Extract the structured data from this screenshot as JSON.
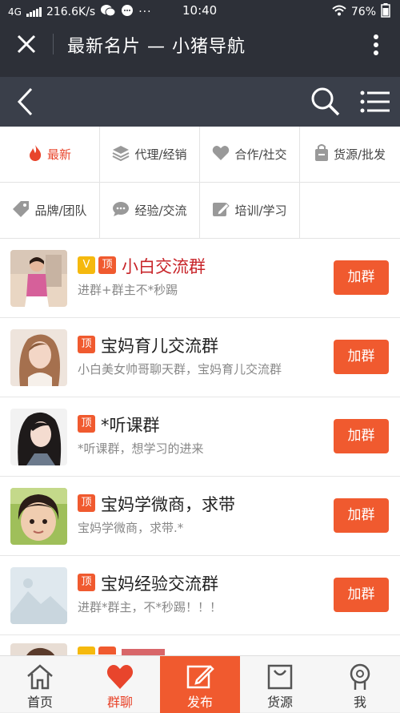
{
  "status_bar": {
    "network": "4G",
    "speed": "216.6K/s",
    "time": "10:40",
    "battery": "76%"
  },
  "wechat_header": {
    "title": "最新名片 — 小猪导航"
  },
  "categories": [
    {
      "label": "最新",
      "icon": "fire-icon",
      "active": true
    },
    {
      "label": "代理/经销",
      "icon": "layers-icon",
      "active": false
    },
    {
      "label": "合作/社交",
      "icon": "heart-icon",
      "active": false
    },
    {
      "label": "货源/批发",
      "icon": "bag-icon",
      "active": false
    },
    {
      "label": "品牌/团队",
      "icon": "tag-icon",
      "active": false
    },
    {
      "label": "经验/交流",
      "icon": "chat-icon",
      "active": false
    },
    {
      "label": "培训/学习",
      "icon": "edit-icon",
      "active": false
    }
  ],
  "groups": [
    {
      "name": "小白交流群",
      "desc": "进群+群主不*秒踢",
      "vip": true,
      "vip_label": "V",
      "top_label": "顶",
      "join_label": "加群"
    },
    {
      "name": "宝妈育儿交流群",
      "desc": "小白美女帅哥聊天群，宝妈育儿交流群",
      "vip": false,
      "top_label": "顶",
      "join_label": "加群"
    },
    {
      "name": "*听课群",
      "desc": "*听课群，想学习的进来",
      "vip": false,
      "top_label": "顶",
      "join_label": "加群"
    },
    {
      "name": "宝妈学微商，求带",
      "desc": "宝妈学微商，求带.*",
      "vip": false,
      "top_label": "顶",
      "join_label": "加群"
    },
    {
      "name": "宝妈经验交流群",
      "desc": "进群*群主，不*秒踢！！！",
      "vip": false,
      "top_label": "顶",
      "join_label": "加群"
    }
  ],
  "tabbar": [
    {
      "label": "首页",
      "icon": "home-icon"
    },
    {
      "label": "群聊",
      "icon": "heart-icon"
    },
    {
      "label": "发布",
      "icon": "edit-icon"
    },
    {
      "label": "货源",
      "icon": "bag-icon"
    },
    {
      "label": "我",
      "icon": "user-icon"
    }
  ],
  "colors": {
    "accent": "#f05a2f",
    "header": "#2d3038",
    "nav": "#3a3f4a"
  }
}
